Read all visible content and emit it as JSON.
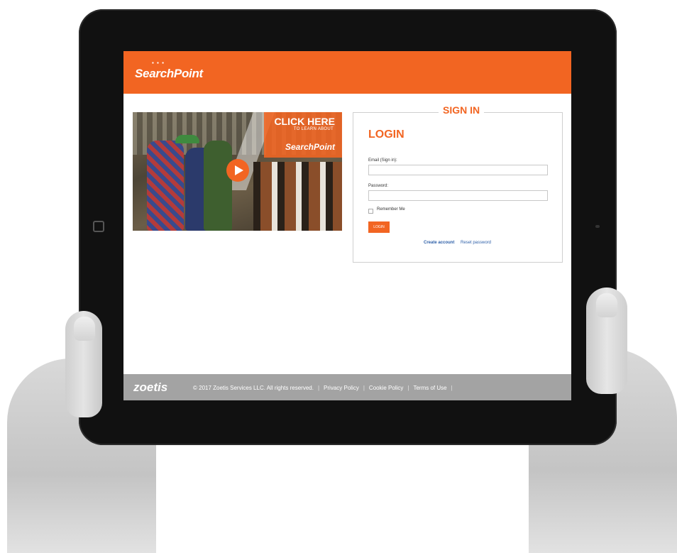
{
  "header": {
    "logo_text": "SearchPoint"
  },
  "video": {
    "title_line": "CLICK HERE",
    "subtitle_line": "TO LEARN ABOUT",
    "logo_text": "SearchPoint",
    "play_icon": "play-icon"
  },
  "signin": {
    "panel_title": "SIGN IN",
    "heading": "LOGIN",
    "email_label": "Email (Sign in):",
    "email_value": "",
    "password_label": "Password:",
    "password_value": "",
    "remember_label": "Remember Me",
    "login_button": "LOGIN",
    "create_account": "Create account",
    "reset_password": "Reset password"
  },
  "footer": {
    "logo_text": "zoetis",
    "copyright": "© 2017 Zoetis Services LLC. All rights reserved.",
    "links": [
      "Privacy Policy",
      "Cookie Policy",
      "Terms of Use"
    ]
  },
  "colors": {
    "brand": "#f26522",
    "footer": "#a3a3a3",
    "link": "#2d5fa8"
  }
}
